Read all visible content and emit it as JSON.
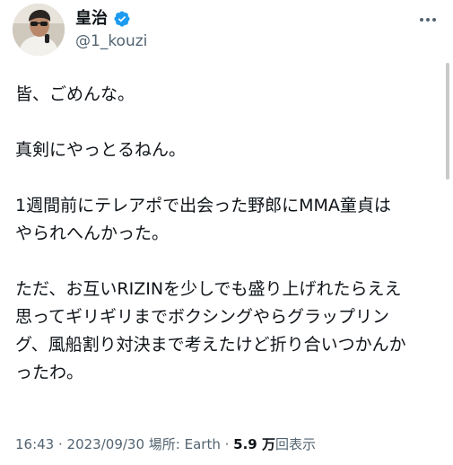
{
  "author": {
    "display_name": "皇治",
    "handle": "@1_kouzi",
    "verified": true,
    "verified_color": "#1d9bf0"
  },
  "icons": {
    "more": "more-dots-icon",
    "verified": "verified-badge-icon",
    "avatar": "avatar-photo"
  },
  "tweet": {
    "paragraphs": [
      [
        "皆、ごめんな。"
      ],
      [
        "真剣にやっとるねん。"
      ],
      [
        "1週間前にテレアポで出会った野郎にMMA童貞は",
        "やられへんかった。"
      ],
      [
        "ただ、お互いRIZINを少しでも盛り上げれたらええ",
        "思ってギリギリまでボクシングやらグラップリン",
        "グ、風船割り対決まで考えたけど折り合いつかんか",
        "ったわ。"
      ]
    ]
  },
  "meta": {
    "time": "16:43",
    "sep1": " · ",
    "date": "2023/09/30",
    "sep2": " ",
    "location_label": "場所: Earth",
    "sep3": " · ",
    "views_count": "5.9 万",
    "views_label": "回表示"
  }
}
